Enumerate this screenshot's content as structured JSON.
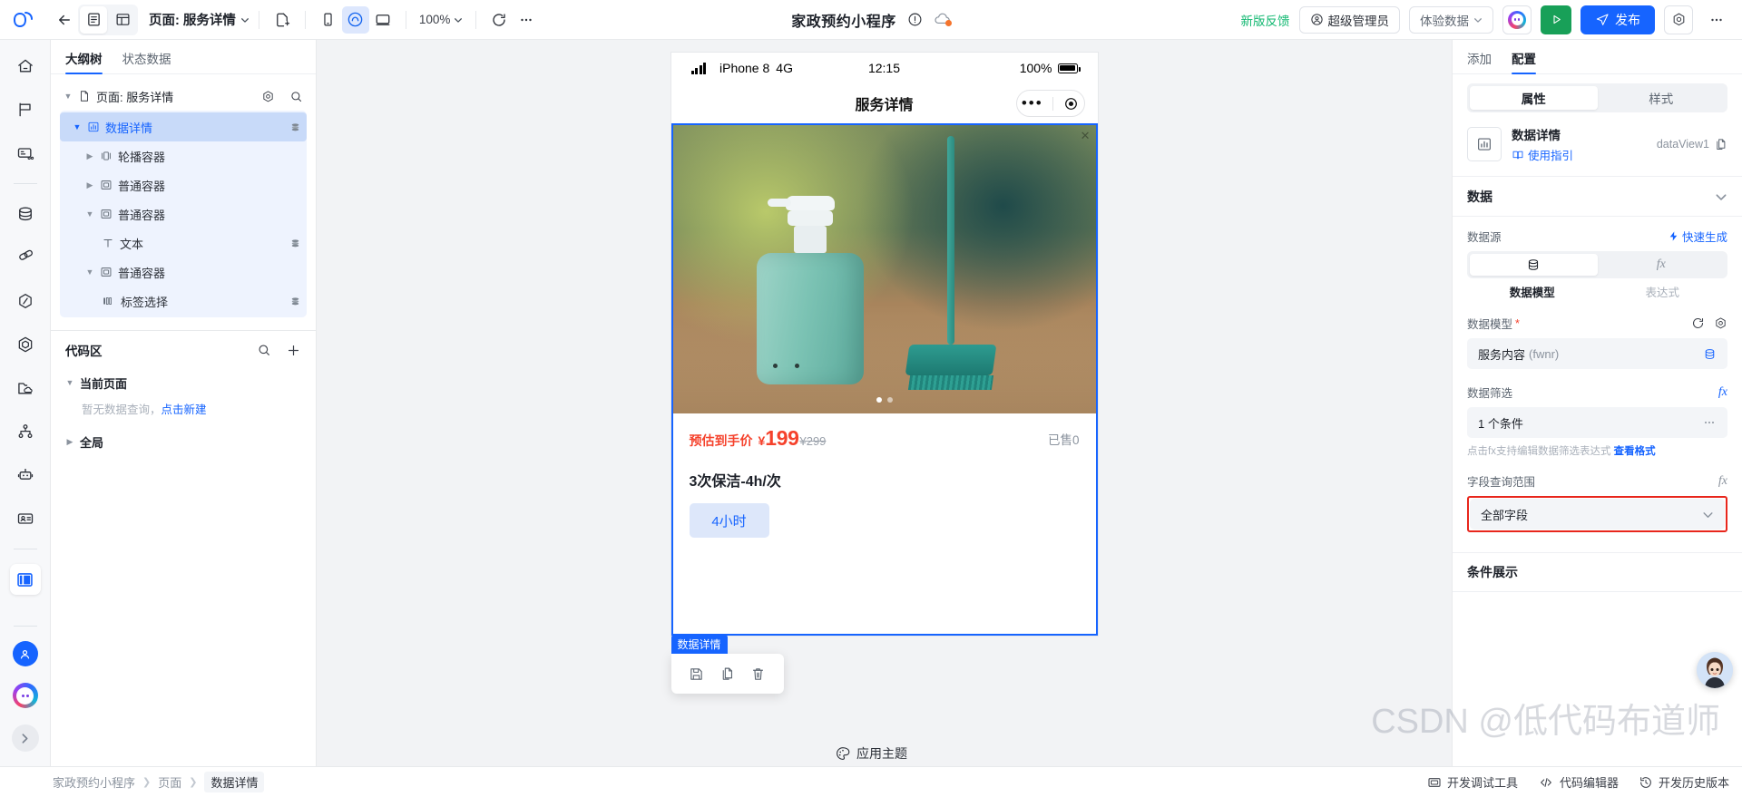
{
  "topbar": {
    "logo": "cloud-logo",
    "back_label": "back-arrow",
    "page_label": "页面: 服务详情",
    "zoom": "100%",
    "app_title": "家政预约小程序",
    "feedback": "新版反馈",
    "role": "超级管理员",
    "env": "体验数据",
    "publish": "发布"
  },
  "rail": {
    "items": [
      {
        "name": "home-icon"
      },
      {
        "name": "flag-icon"
      },
      {
        "name": "card-cart-icon"
      },
      {
        "name": "database-icon"
      },
      {
        "name": "link-icon"
      },
      {
        "name": "slash-hex-icon"
      },
      {
        "name": "hexagon-icon"
      },
      {
        "name": "folder-cloud-icon"
      },
      {
        "name": "sitemap-icon"
      },
      {
        "name": "robot-icon"
      },
      {
        "name": "id-card-icon"
      },
      {
        "name": "layout-icon"
      }
    ]
  },
  "left_panel": {
    "tabs": [
      {
        "label": "大纲树",
        "active": true
      },
      {
        "label": "状态数据",
        "active": false
      }
    ],
    "tree_root": "页面: 服务详情",
    "tree": [
      {
        "label": "数据详情",
        "icon": "chart-icon",
        "depth": 0,
        "expanded": true,
        "selected": true,
        "has_db": true
      },
      {
        "label": "轮播容器",
        "icon": "carousel-icon",
        "depth": 1,
        "expanded": false,
        "selected": false,
        "has_db": false
      },
      {
        "label": "普通容器",
        "icon": "container-icon",
        "depth": 1,
        "expanded": false,
        "selected": false,
        "has_db": false
      },
      {
        "label": "普通容器",
        "icon": "container-icon",
        "depth": 1,
        "expanded": true,
        "selected": false,
        "has_db": false
      },
      {
        "label": "文本",
        "icon": "text-icon",
        "depth": 2,
        "expanded": null,
        "selected": false,
        "has_db": true
      },
      {
        "label": "普通容器",
        "icon": "container-icon",
        "depth": 1,
        "expanded": true,
        "selected": false,
        "has_db": false
      },
      {
        "label": "标签选择",
        "icon": "tag-select-icon",
        "depth": 2,
        "expanded": null,
        "selected": false,
        "has_db": true
      }
    ],
    "code_area": {
      "title": "代码区",
      "groups": [
        {
          "label": "当前页面",
          "expanded": true
        },
        {
          "label": "全局",
          "expanded": false
        }
      ],
      "empty_text": "暂无数据查询，",
      "empty_link": "点击新建"
    }
  },
  "phone": {
    "status": {
      "device": "iPhone 8",
      "network": "4G",
      "time": "12:15",
      "battery": "100%"
    },
    "nav_title": "服务详情",
    "price_label": "预估到手价",
    "currency": "¥",
    "price": "199",
    "original_price": "¥299",
    "sold": "已售0",
    "product_title": "3次保洁-4h/次",
    "chip": "4小时",
    "float_badge": "数据详情",
    "float_actions": [
      "save-icon",
      "copy-icon",
      "delete-icon"
    ]
  },
  "right_panel": {
    "tabs": [
      {
        "label": "添加",
        "active": false
      },
      {
        "label": "配置",
        "active": true
      }
    ],
    "segment": [
      {
        "label": "属性",
        "active": true
      },
      {
        "label": "样式",
        "active": false
      }
    ],
    "component": {
      "name": "数据详情",
      "guide": "使用指引",
      "id": "dataView1",
      "icon": "chart-bar-icon"
    },
    "data_section": {
      "title": "数据",
      "source_label": "数据源",
      "quick_gen": "快速生成",
      "source_tabs": [
        {
          "label": "数据模型",
          "active": true,
          "icon": "database-icon"
        },
        {
          "label": "表达式",
          "active": false,
          "icon": "fx-icon"
        }
      ],
      "model_label": "数据模型",
      "model_required": "*",
      "model_value": "服务内容",
      "model_code": "(fwnr)",
      "filter_label": "数据筛选",
      "filter_value": "1 个条件",
      "filter_hint": "点击fx支持编辑数据筛选表达式",
      "filter_hint_link": "查看格式",
      "field_scope_label": "字段查询范围",
      "field_scope_value": "全部字段",
      "highlight_color": "#e8261c"
    },
    "condition_section": {
      "title": "条件展示"
    }
  },
  "bottom": {
    "breadcrumb": [
      "家政预约小程序",
      "页面",
      "数据详情"
    ],
    "actions": [
      {
        "label": "开发调试工具",
        "icon": "debug-icon"
      },
      {
        "label": "代码编辑器",
        "icon": "code-icon"
      },
      {
        "label": "开发历史版本",
        "icon": "history-icon"
      }
    ]
  },
  "overlay": {
    "watermark": "CSDN @低代码布道师",
    "theme_button": "应用主题"
  },
  "colors": {
    "primary": "#1664ff",
    "danger": "#e8261c",
    "price": "#f5422c",
    "green": "#12b871"
  }
}
